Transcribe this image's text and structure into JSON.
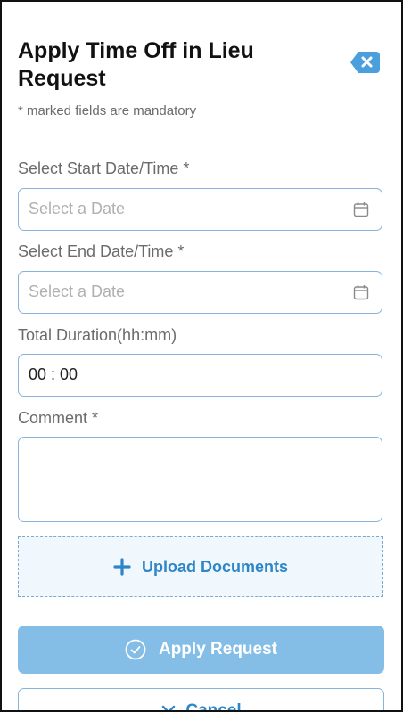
{
  "header": {
    "title": "Apply Time Off in Lieu Request",
    "subtitle": "* marked fields are mandatory",
    "close_icon": "backspace-close-icon"
  },
  "form": {
    "start": {
      "label": "Select Start Date/Time *",
      "placeholder": "Select a Date",
      "icon": "calendar-icon"
    },
    "end": {
      "label": "Select End Date/Time *",
      "placeholder": "Select a Date",
      "icon": "calendar-icon"
    },
    "duration": {
      "label": "Total Duration(hh:mm)",
      "value": "00 : 00"
    },
    "comment": {
      "label": "Comment *",
      "value": ""
    }
  },
  "upload": {
    "label": "Upload Documents",
    "icon": "plus-icon"
  },
  "actions": {
    "apply_label": "Apply Request",
    "apply_icon": "check-circle-icon",
    "cancel_label": "Cancel",
    "cancel_icon": "close-icon"
  },
  "colors": {
    "accent": "#2e86c9",
    "apply_bg": "#84bde6",
    "border": "#86b4dd",
    "close_bg": "#4a9fdc"
  }
}
